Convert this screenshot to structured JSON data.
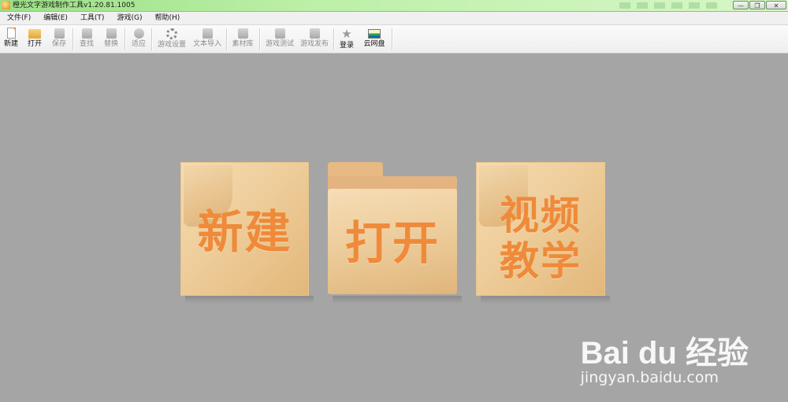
{
  "window": {
    "title": "橙光文字游戏制作工具v1.20.81.1005",
    "buttons": {
      "minimize": "—",
      "restore": "❐",
      "close": "✕"
    }
  },
  "menu": [
    {
      "label": "文件(F)"
    },
    {
      "label": "编辑(E)"
    },
    {
      "label": "工具(T)"
    },
    {
      "label": "游戏(G)"
    },
    {
      "label": "帮助(H)"
    }
  ],
  "toolbar": {
    "new": "新建",
    "open": "打开",
    "save": "保存",
    "find": "查找",
    "replace": "替换",
    "adapt": "适应",
    "game_settings": "游戏设置",
    "text_import": "文本导入",
    "asset_library": "素材库",
    "game_test": "游戏测试",
    "game_publish": "游戏发布",
    "login": "登录",
    "cloud_drive": "云网盘"
  },
  "start_cards": {
    "new": "新建",
    "open": "打开",
    "tutorial_line1": "视频",
    "tutorial_line2": "教学"
  },
  "watermark": {
    "logo": "Bai du 经验",
    "url": "jingyan.baidu.com"
  }
}
